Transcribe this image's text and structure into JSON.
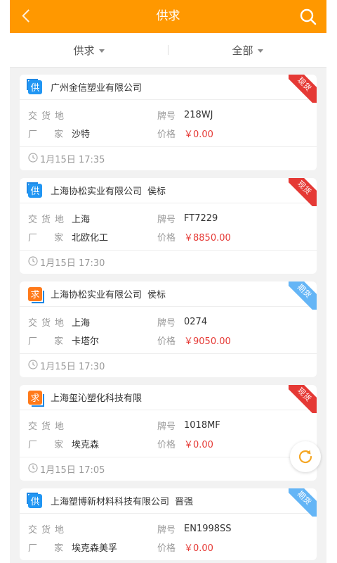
{
  "header": {
    "title": "供求"
  },
  "filters": [
    {
      "label": "供求"
    },
    {
      "label": "全部"
    }
  ],
  "labels": {
    "delivery": "交货地",
    "factory_1": "厂",
    "factory_2": "家",
    "brand": "牌号",
    "price": "价格"
  },
  "colors": {
    "accent": "#ff9800",
    "price": "#e53935",
    "badge_red": "#e53935",
    "badge_blue": "#64b5f6"
  },
  "cards": [
    {
      "type": "supply",
      "type_text": "供",
      "company": "广州金信塑业有限公司",
      "tag": "",
      "badge": "现货",
      "badge_color": "red",
      "delivery": "",
      "factory": "沙特",
      "brand": "218WJ",
      "price": "￥0.00",
      "time": "1月15日 17:35"
    },
    {
      "type": "supply",
      "type_text": "供",
      "company": "上海协松实业有限公司",
      "tag": "侯标",
      "badge": "现货",
      "badge_color": "red",
      "delivery": "上海",
      "factory": "北欧化工",
      "brand": "FT7229",
      "price": "￥8850.00",
      "time": "1月15日 17:30"
    },
    {
      "type": "demand",
      "type_text": "求",
      "company": "上海协松实业有限公司",
      "tag": "侯标",
      "badge": "期货",
      "badge_color": "blue",
      "delivery": "上海",
      "factory": "卡塔尔",
      "brand": "0274",
      "price": "￥9050.00",
      "time": "1月15日 17:30"
    },
    {
      "type": "demand",
      "type_text": "求",
      "company": "上海玺沁塑化科技有限",
      "tag": "",
      "badge": "现货",
      "badge_color": "red",
      "delivery": "",
      "factory": "埃克森",
      "brand": "1018MF",
      "price": "￥0.00",
      "time": "1月15日 17:05"
    },
    {
      "type": "supply",
      "type_text": "供",
      "company": "上海塑博新材料科技有限公司",
      "tag": "晋强",
      "badge": "期货",
      "badge_color": "blue",
      "delivery": "",
      "factory": "埃克森美孚",
      "brand": "EN1998SS",
      "price": "￥0.00",
      "time": ""
    }
  ]
}
